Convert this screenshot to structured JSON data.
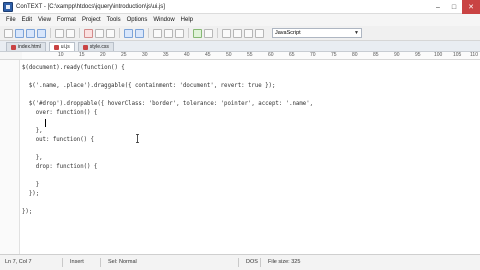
{
  "window": {
    "title": "ConTEXT - [C:\\xampp\\htdocs\\jquery\\introduction\\js\\ui.js]",
    "minimize": "–",
    "maximize": "□",
    "close": "✕"
  },
  "menu": [
    "File",
    "Edit",
    "View",
    "Format",
    "Project",
    "Tools",
    "Options",
    "Window",
    "Help"
  ],
  "toolbar": {
    "language": "JavaScript"
  },
  "tabs": [
    {
      "label": "index.html"
    },
    {
      "label": "ui.js"
    },
    {
      "label": "style.css"
    }
  ],
  "ruler": [
    "10",
    "15",
    "20",
    "25",
    "30",
    "35",
    "40",
    "45",
    "50",
    "55",
    "60",
    "65",
    "70",
    "75",
    "80",
    "85",
    "90",
    "95",
    "100",
    "105",
    "110"
  ],
  "code": [
    "$(document).ready(function() {",
    "",
    "  $('.name, .place').draggable({ containment: 'document', revert: true });",
    "",
    "  $('#drop').droppable({ hoverClass: 'border', tolerance: 'pointer', accept: '.name',",
    "    over: function() {",
    "",
    "    },",
    "    out: function() {",
    "",
    "    },",
    "    drop: function() {",
    "",
    "    }",
    "  });",
    "",
    "});"
  ],
  "status": {
    "position": "Ln 7, Col 7",
    "mode": "Insert",
    "selection": "Sel: Normal",
    "format": "DOS",
    "filesize": "File size: 325"
  }
}
